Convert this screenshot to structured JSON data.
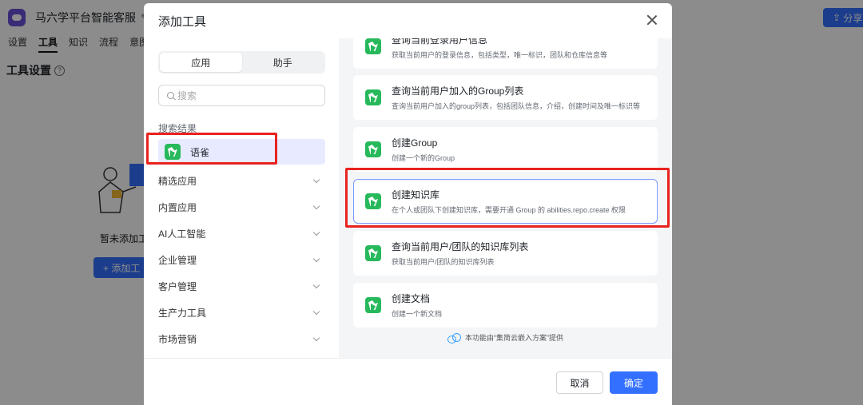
{
  "background": {
    "app_title": "马六学平台智能客服",
    "share_label": "分享",
    "tabs": [
      "设置",
      "工具",
      "知识",
      "流程",
      "意图"
    ],
    "active_tab": "工具",
    "section_title": "工具设置",
    "empty_text": "暂未添加工",
    "add_button": "+ 添加工"
  },
  "modal": {
    "title": "添加工具",
    "segments": [
      "应用",
      "助手"
    ],
    "active_segment": "应用",
    "search_placeholder": "搜索",
    "results_label": "搜索结果",
    "result_item": "语雀",
    "categories": [
      "精选应用",
      "内置应用",
      "AI人工智能",
      "企业管理",
      "客户管理",
      "生产力工具",
      "市场营销"
    ],
    "tools": [
      {
        "title": "查询当前登录用户信息",
        "desc": "获取当前用户的登录信息，包括类型，唯一标识，团队和仓库信息等"
      },
      {
        "title": "查询当前用户加入的Group列表",
        "desc": "查询当前用户加入的group列表，包括团队信息，介绍，创建时间及唯一标识等"
      },
      {
        "title": "创建Group",
        "desc": "创建一个新的Group"
      },
      {
        "title": "创建知识库",
        "desc": "在个人或团队下创建知识库，需要开通 Group 的 abilities.repo.create 权限"
      },
      {
        "title": "查询当前用户/团队的知识库列表",
        "desc": "获取当前用户/团队的知识库列表"
      },
      {
        "title": "创建文档",
        "desc": "创建一个新文档"
      }
    ],
    "provider_text": "本功能由“集简云嵌入方案”提供",
    "cancel_label": "取消",
    "confirm_label": "确定"
  },
  "colors": {
    "accent": "#3370ff",
    "yuque_green": "#27b95b",
    "highlight_red": "#e8231f"
  }
}
